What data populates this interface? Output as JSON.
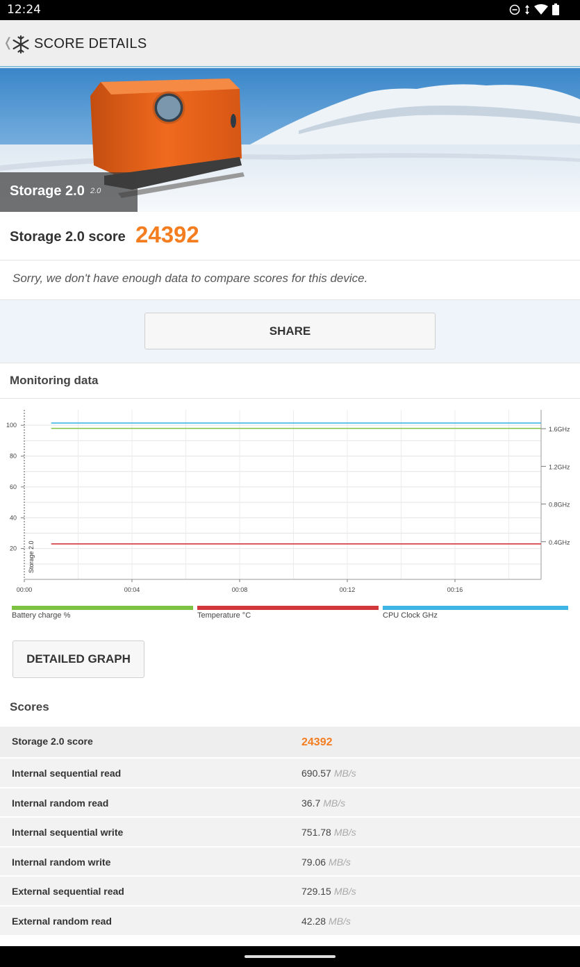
{
  "status_bar": {
    "time": "12:24",
    "icons": [
      "do-not-disturb-icon",
      "data-arrows-icon",
      "wifi-icon",
      "battery-icon"
    ]
  },
  "app_bar": {
    "title": "SCORE DETAILS",
    "back_icon": "chevron-left-icon",
    "logo_icon": "snowflake-logo-icon"
  },
  "hero": {
    "test_name": "Storage 2.0",
    "version": "2.0"
  },
  "score": {
    "label": "Storage 2.0 score",
    "value": "24392"
  },
  "compare_message": "Sorry, we don't have enough data to compare scores for this device.",
  "share_button": "SHARE",
  "monitoring": {
    "title": "Monitoring data",
    "vertical_marker_label": "Storage 2.0",
    "legend": [
      {
        "label": "Battery charge %",
        "color": "#7dc243"
      },
      {
        "label": "Temperature °C",
        "color": "#d2373b"
      },
      {
        "label": "CPU Clock GHz",
        "color": "#3fb5e5"
      }
    ],
    "detailed_graph_button": "DETAILED GRAPH"
  },
  "chart_data": {
    "type": "line",
    "x": [
      "00:00",
      "00:04",
      "00:08",
      "00:12",
      "00:16"
    ],
    "left_axis": {
      "ticks": [
        20,
        40,
        60,
        80,
        100
      ],
      "ylim": [
        0,
        110
      ]
    },
    "right_axis": {
      "ticks": [
        "0.4GHz",
        "0.8GHz",
        "1.2GHz",
        "1.6GHz"
      ],
      "ylim": [
        0,
        1.8
      ]
    },
    "xlim_minutes": [
      0,
      19.2
    ],
    "series": [
      {
        "name": "CPU Clock GHz",
        "color": "#3fb5e5",
        "axis": "right",
        "x_minutes": [
          1,
          19.2
        ],
        "values": [
          1.66,
          1.66
        ]
      },
      {
        "name": "Battery charge %",
        "color": "#7dc243",
        "axis": "left",
        "x_minutes": [
          1,
          19.2
        ],
        "values": [
          98,
          98
        ]
      },
      {
        "name": "Temperature °C",
        "color": "#d2373b",
        "axis": "left",
        "x_minutes": [
          1,
          19.2
        ],
        "values": [
          23,
          23
        ]
      }
    ],
    "grid": true
  },
  "scores": {
    "title": "Scores",
    "rows": [
      {
        "label": "Storage 2.0 score",
        "value": "24392",
        "unit": ""
      },
      {
        "label": "Internal sequential read",
        "value": "690.57",
        "unit": "MB/s"
      },
      {
        "label": "Internal random read",
        "value": "36.7",
        "unit": "MB/s"
      },
      {
        "label": "Internal sequential write",
        "value": "751.78",
        "unit": "MB/s"
      },
      {
        "label": "Internal random write",
        "value": "79.06",
        "unit": "MB/s"
      },
      {
        "label": "External sequential read",
        "value": "729.15",
        "unit": "MB/s"
      },
      {
        "label": "External random read",
        "value": "42.28",
        "unit": "MB/s"
      }
    ]
  }
}
